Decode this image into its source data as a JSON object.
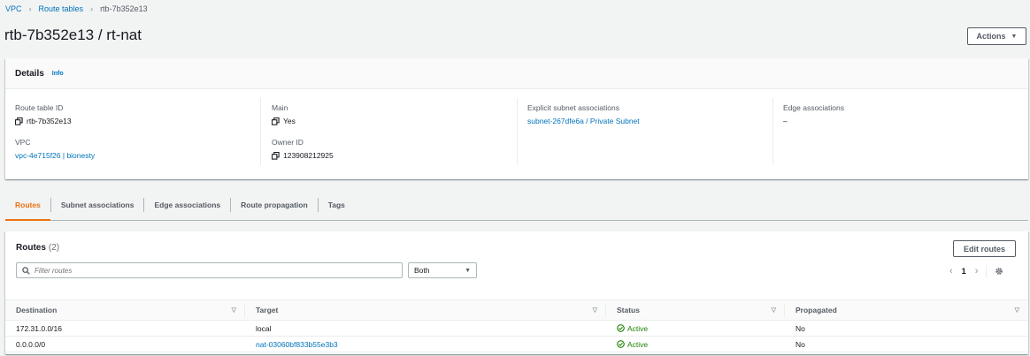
{
  "breadcrumb": {
    "items": [
      "VPC",
      "Route tables"
    ],
    "current": "rtb-7b352e13"
  },
  "page": {
    "title": "rtb-7b352e13 / rt-nat",
    "actions_label": "Actions"
  },
  "details": {
    "title": "Details",
    "info": "Info",
    "fields": {
      "route_table_id": {
        "label": "Route table ID",
        "value": "rtb-7b352e13"
      },
      "vpc": {
        "label": "VPC",
        "value": "vpc-4e715f26 | bionesty"
      },
      "main": {
        "label": "Main",
        "value": "Yes"
      },
      "owner_id": {
        "label": "Owner ID",
        "value": "123908212925"
      },
      "explicit_subnet": {
        "label": "Explicit subnet associations",
        "value": "subnet-267dfe6a / Private Subnet"
      },
      "edge": {
        "label": "Edge associations",
        "value": "–"
      }
    }
  },
  "tabs": [
    "Routes",
    "Subnet associations",
    "Edge associations",
    "Route propagation",
    "Tags"
  ],
  "routes": {
    "title": "Routes",
    "count": "(2)",
    "edit_label": "Edit routes",
    "filter_placeholder": "Filter routes",
    "select_value": "Both",
    "page": "1",
    "columns": [
      "Destination",
      "Target",
      "Status",
      "Propagated"
    ],
    "rows": [
      {
        "destination": "172.31.0.0/16",
        "target": "local",
        "status": "Active",
        "propagated": "No"
      },
      {
        "destination": "0.0.0.0/0",
        "target": "nat-03060bf833b55e3b3",
        "status": "Active",
        "propagated": "No"
      }
    ]
  },
  "colors": {
    "link": "#0073bb",
    "active_tab": "#ec7211",
    "status_active": "#1d8102"
  }
}
